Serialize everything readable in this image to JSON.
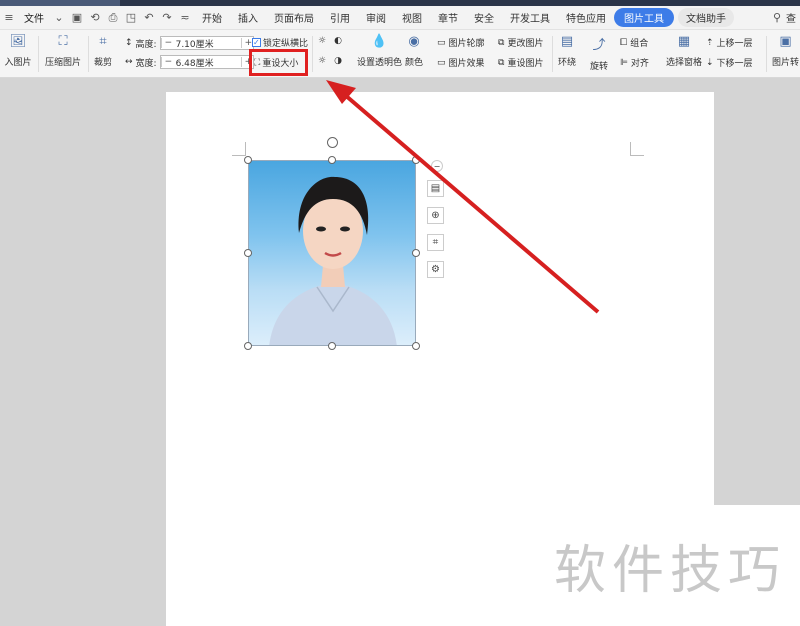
{
  "menubar": {
    "file_label": "文件",
    "tabs": [
      "开始",
      "插入",
      "页面布局",
      "引用",
      "审阅",
      "视图",
      "章节",
      "安全",
      "开发工具",
      "特色应用"
    ],
    "active_tab": "图片工具",
    "assistant_tab": "文档助手",
    "search_label": "查"
  },
  "ribbon": {
    "insert_pic": "入图片",
    "compress": "压缩图片",
    "crop": "裁剪",
    "height_label": "高度:",
    "height_value": "7.10厘米",
    "width_label": "宽度:",
    "width_value": "6.48厘米",
    "lock_ratio": "锁定纵横比",
    "reset_size": "重设大小",
    "transparent": "设置透明色",
    "color": "颜色",
    "outline": "图片轮廓",
    "effect": "图片效果",
    "change_pic": "更改图片",
    "reset_pic": "重设图片",
    "wrap": "环绕",
    "rotate": "旋转",
    "group": "组合",
    "align": "对齐",
    "select_pane": "选择窗格",
    "bring_forward": "上移一层",
    "send_backward": "下移一层",
    "pic_more": "图片转"
  },
  "watermark": "软件技巧",
  "colors": {
    "accent": "#3d7ce8",
    "highlight": "#e02020",
    "arrow": "#d62020"
  }
}
